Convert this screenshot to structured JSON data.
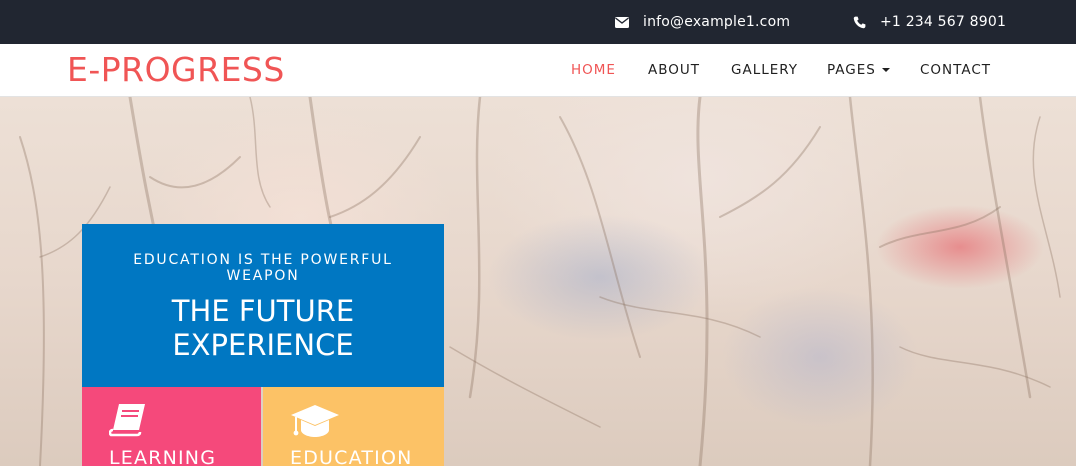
{
  "topbar": {
    "email": "info@example1.com",
    "phone": "+1 234 567 8901",
    "email_icon": "envelope-icon",
    "phone_icon": "phone-icon"
  },
  "navbar": {
    "brand": "E-PROGRESS",
    "items": [
      {
        "label": "HOME",
        "active": true
      },
      {
        "label": "ABOUT",
        "active": false
      },
      {
        "label": "GALLERY",
        "active": false
      },
      {
        "label": "PAGES",
        "active": false,
        "has_dropdown": true
      },
      {
        "label": "CONTACT",
        "active": false
      }
    ]
  },
  "hero": {
    "subtitle": "EDUCATION IS THE POWERFUL WEAPON",
    "title_line1": "THE FUTURE",
    "title_line2": "EXPERIENCE",
    "features": [
      {
        "label": "LEARNING",
        "icon": "book-icon",
        "color": "#f5497b"
      },
      {
        "label": "EDUCATION",
        "icon": "graduation-cap-icon",
        "color": "#fcc266"
      }
    ]
  },
  "colors": {
    "topbar_bg": "#212631",
    "brand": "#f05555",
    "card_bg": "#0077c2"
  }
}
